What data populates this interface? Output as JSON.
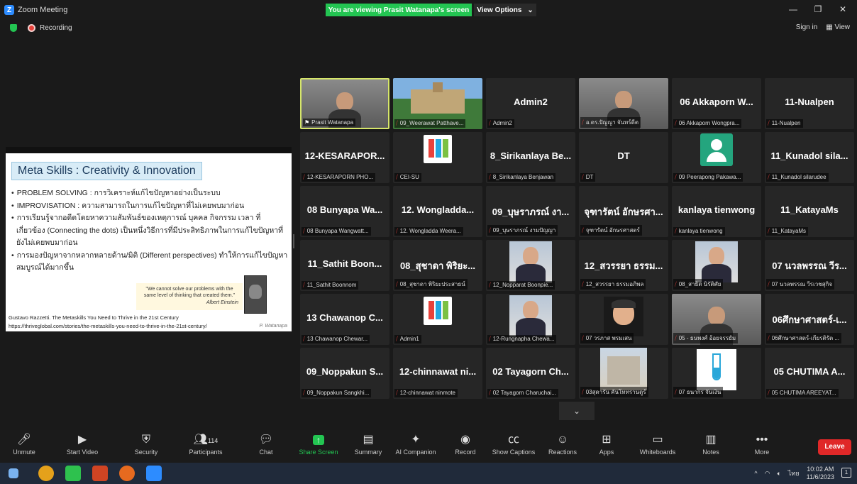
{
  "window": {
    "title": "Zoom Meeting",
    "viewing_banner": "You are viewing Prasit Watanapa's screen",
    "view_options": "View Options",
    "recording": "Recording",
    "sign_in": "Sign in",
    "view": "View"
  },
  "slide": {
    "title": "Meta Skills : Creativity & Innovation",
    "bullets": [
      "PROBLEM SOLVING : การวิเคราะห์แก้ไขปัญหาอย่างเป็นระบบ",
      "IMPROVISATION : ความสามารถในการแก้ไขปัญหาที่ไม่เคยพบมาก่อน",
      "การเรียนรู้จากอดีตโดยหาความสัมพันธ์ของเหตุการณ์ บุคคล กิจกรรม เวลา ที่เกี่ยวข้อง (Connecting the dots) เป็นหนึ่งวิธีการที่มีประสิทธิภาพในการแก้ไขปัญหาที่ยังไม่เคยพบมาก่อน",
      "การมองปัญหาจากหลากหลายด้าน/มิติ (Different perspectives) ทำให้การแก้ไขปัญหาสมบูรณ์ได้มากขึ้น"
    ],
    "quote": "\"We cannot solve our problems with the same level of thinking that created them.\"",
    "quote_author": "Albert Einstein",
    "citation": "Gustavo Razzetti. The Metaskills You Need to Thrive in the 21st Century",
    "url": "https://thriveglobal.com/stories/the-metaskills-you-need-to-thrive-in-the-21st-century/",
    "signature": "P. Watanapa"
  },
  "participants_grid": [
    {
      "big": "",
      "label": "Prasit Watanapa",
      "kind": "video-person",
      "active": true
    },
    {
      "big": "",
      "label": "09_Weerawat Patthave...",
      "kind": "video-building"
    },
    {
      "big": "Admin2",
      "label": "Admin2",
      "kind": "name"
    },
    {
      "big": "",
      "label": "อ.ดร.ปัญญา จันทร์ดีต",
      "kind": "video-person"
    },
    {
      "big": "06 Akkaporn W...",
      "label": "06 Akkaporn Wongpra...",
      "kind": "name"
    },
    {
      "big": "11-Nualpen",
      "label": "11-Nualpen",
      "kind": "name"
    },
    {
      "big": "12-KESARAPOR...",
      "label": "12-KESARAPORN PHO...",
      "kind": "name"
    },
    {
      "big": "",
      "label": "CEI-SU",
      "kind": "logo"
    },
    {
      "big": "8_Sirikanlaya Be...",
      "label": "8_Sirikanlaya Benjawan",
      "kind": "name"
    },
    {
      "big": "DT",
      "label": "DT",
      "kind": "name"
    },
    {
      "big": "",
      "label": "09 Peerapong Pakawa...",
      "kind": "avatar"
    },
    {
      "big": "11_Kunadol sila...",
      "label": "11_Kunadol silarudee",
      "kind": "name"
    },
    {
      "big": "08 Bunyapa Wa...",
      "label": "08 Bunyapa Wangwatt...",
      "kind": "name"
    },
    {
      "big": "12. Wongladda...",
      "label": "12. Wongladda Weera...",
      "kind": "name"
    },
    {
      "big": "09_บุษราภรณ์ งา...",
      "label": "09_บุษราภรณ์ งามปัญญา",
      "kind": "name"
    },
    {
      "big": "จุฑารัตน์ อักษรศา...",
      "label": "จุฑารัตน์ อักษรศาสตร์",
      "kind": "name"
    },
    {
      "big": "kanlaya tienwong",
      "label": "kanlaya tienwong",
      "kind": "name"
    },
    {
      "big": "11_KatayaMs",
      "label": "11_KatayaMs",
      "kind": "name"
    },
    {
      "big": "11_Sathit Boon...",
      "label": "11_Sathit Boonnom",
      "kind": "name"
    },
    {
      "big": "08_สุชาดา พิริยะ...",
      "label": "08_สุชาดา พิริยะประสาธน์",
      "kind": "name"
    },
    {
      "big": "",
      "label": "12_Nopparat Boonpie...",
      "kind": "photo"
    },
    {
      "big": "12_สวรรยา ธรรม...",
      "label": "12_สวรรยา ธรรมอภิพล",
      "kind": "name"
    },
    {
      "big": "",
      "label": "08_สาธิต นิรัติศัย",
      "kind": "photo"
    },
    {
      "big": "07 นวลพรรณ วีร...",
      "label": "07 นวลพรรณ วีรเวชสุกิจ",
      "kind": "name"
    },
    {
      "big": "13 Chawanop C...",
      "label": "13 Chawanop Chewar...",
      "kind": "name"
    },
    {
      "big": "",
      "label": "Admin1",
      "kind": "logo"
    },
    {
      "big": "",
      "label": "12-Rungnapha Chewa...",
      "kind": "photo"
    },
    {
      "big": "",
      "label": "07 วรภาส พรมเสน",
      "kind": "cartoon"
    },
    {
      "big": "",
      "label": "05 - ธนพงศ์ อ้อยจรรยัม",
      "kind": "video-person"
    },
    {
      "big": "06ศึกษาศาสตร์-เ...",
      "label": "06ศึกษาศาสตร์-เกียรติรัต ...",
      "kind": "name"
    },
    {
      "big": "09_Noppakun S...",
      "label": "09_Noppakun Sangkhi...",
      "kind": "name"
    },
    {
      "big": "12-chinnawat ni...",
      "label": "12-chinnawat ninmote",
      "kind": "name"
    },
    {
      "big": "02 Tayagorn Ch...",
      "label": "02 Tayagorn Charuchai...",
      "kind": "name"
    },
    {
      "big": "",
      "label": "03สุดารัน คันโททรานดูร์",
      "kind": "cathedral"
    },
    {
      "big": "",
      "label": "07 ธนากร จันเงิน",
      "kind": "testtube"
    },
    {
      "big": "05 CHUTIMA A...",
      "label": "05 CHUTIMA AREEYAT...",
      "kind": "name"
    }
  ],
  "toolbar": {
    "unmute": "Unmute",
    "start_video": "Start Video",
    "security": "Security",
    "participants": "Participants",
    "participants_count": "114",
    "chat": "Chat",
    "share_screen": "Share Screen",
    "summary": "Summary",
    "ai_companion": "AI Companion",
    "record": "Record",
    "show_captions": "Show Captions",
    "reactions": "Reactions",
    "apps": "Apps",
    "whiteboards": "Whiteboards",
    "notes": "Notes",
    "more": "More",
    "leave": "Leave"
  },
  "taskbar": {
    "lang": "ไทย",
    "time": "10:02 AM",
    "date": "11/6/2023",
    "notif_count": "1"
  }
}
